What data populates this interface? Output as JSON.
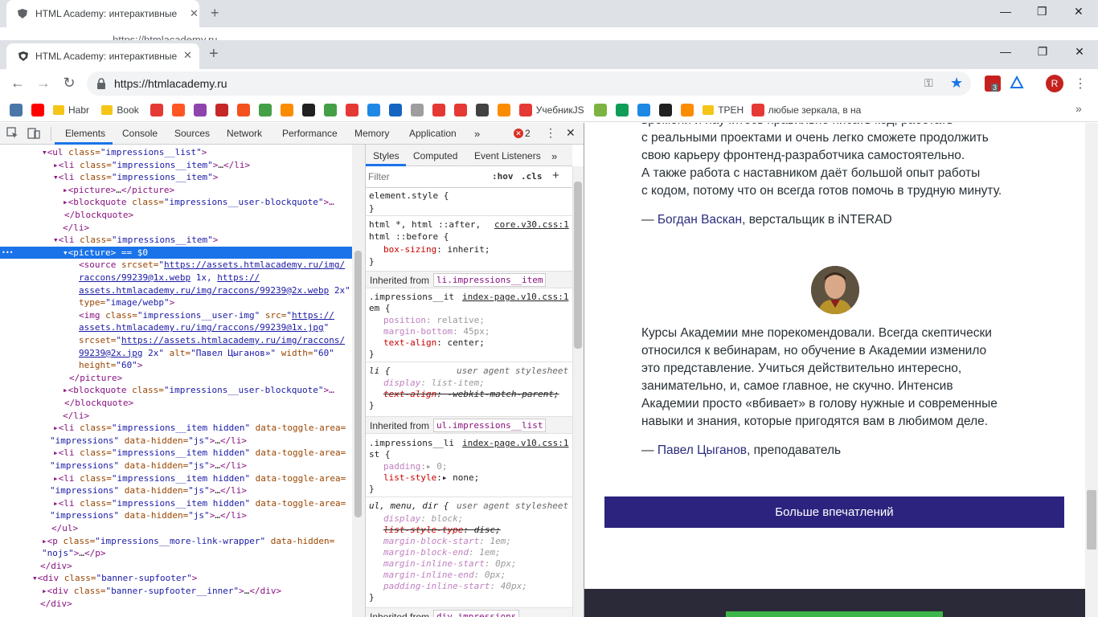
{
  "browser": {
    "tab_title": "HTML Academy: интерактивные",
    "url": "https://htmlacademy.ru",
    "ghost_url": "https://htmlacademy.ru",
    "profile_initial": "R",
    "ext_badge": "3"
  },
  "bookmarks": [
    {
      "label": "",
      "color": "#4a76a8"
    },
    {
      "label": "",
      "color": "#ff0000"
    },
    {
      "label": "Habr",
      "folder": true
    },
    {
      "label": "Book",
      "folder": true
    },
    {
      "label": "",
      "color": "#e53935"
    },
    {
      "label": "",
      "color": "#ff5722"
    },
    {
      "label": "",
      "color": "#8e44ad"
    },
    {
      "label": "",
      "color": "#c62828"
    },
    {
      "label": "",
      "color": "#f4511e"
    },
    {
      "label": "",
      "color": "#43a047"
    },
    {
      "label": "",
      "color": "#fb8c00"
    },
    {
      "label": "",
      "color": "#212121"
    },
    {
      "label": "",
      "color": "#43a047"
    },
    {
      "label": "",
      "color": "#e53935"
    },
    {
      "label": "",
      "color": "#1e88e5"
    },
    {
      "label": "",
      "color": "#1565c0"
    },
    {
      "label": "",
      "color": "#9e9e9e"
    },
    {
      "label": "",
      "color": "#e53935"
    },
    {
      "label": "",
      "color": "#e53935"
    },
    {
      "label": "",
      "color": "#424242"
    },
    {
      "label": "",
      "color": "#fb8c00"
    },
    {
      "label": "УчебникJS",
      "color": "#e53935"
    },
    {
      "label": "",
      "color": "#7cb342"
    },
    {
      "label": "",
      "color": "#0f9d58"
    },
    {
      "label": "",
      "color": "#1e88e5"
    },
    {
      "label": "",
      "color": "#212121"
    },
    {
      "label": "",
      "color": "#fb8c00"
    },
    {
      "label": "ТРЕН",
      "folder": true
    },
    {
      "label": "любые зеркала, в на",
      "color": "#e53935"
    }
  ],
  "devtools": {
    "tabs": [
      "Elements",
      "Console",
      "Sources",
      "Network",
      "Performance",
      "Memory",
      "Application"
    ],
    "error_count": "2",
    "styles_tabs": [
      "Styles",
      "Computed",
      "Event Listeners"
    ],
    "filter_placeholder": "Filter",
    "hov": ":hov",
    "cls": ".cls"
  },
  "elements_tree": [
    [
      {
        "t": "▾<"
      },
      {
        "t": "ul"
      },
      {
        "a": " class="
      },
      {
        "v": "\"impressions__list\""
      },
      {
        "t": ">"
      }
    ],
    [
      {
        "t": "▸<li "
      },
      {
        "a": "class="
      },
      {
        "v": "\"impressions__item\""
      },
      {
        "t": ">"
      },
      {
        "x": "…"
      },
      {
        "t": "</li>"
      }
    ],
    [
      {
        "t": "▾<li "
      },
      {
        "a": "class="
      },
      {
        "v": "\"impressions__item\""
      },
      {
        "t": ">"
      }
    ],
    [
      {
        "t": "▸<picture>"
      },
      {
        "x": "…"
      },
      {
        "t": "</picture>"
      }
    ],
    [
      {
        "t": "▸<blockquote "
      },
      {
        "a": "class="
      },
      {
        "v": "\"impressions__user-blockquote\""
      },
      {
        "t": ">…"
      }
    ],
    [
      {
        "t": "</blockquote>"
      }
    ],
    [
      {
        "t": "</li>"
      }
    ],
    [
      {
        "t": "▾<li "
      },
      {
        "a": "class="
      },
      {
        "v": "\"impressions__item\""
      },
      {
        "t": ">"
      }
    ],
    [
      {
        "t": "▾<picture>"
      },
      {
        "x": " == $0"
      }
    ],
    [
      {
        "t": "<source "
      },
      {
        "a": "srcset="
      },
      {
        "v": "\""
      },
      {
        "l": "https://assets.htmlacademy.ru/img/"
      }
    ],
    [
      {
        "l": "raccons/99239@1x.webp"
      },
      {
        "v": " 1x, "
      },
      {
        "l": "https://"
      }
    ],
    [
      {
        "l": "assets.htmlacademy.ru/img/raccons/99239@2x.webp"
      },
      {
        "v": " 2x\""
      }
    ],
    [
      {
        "a": "type="
      },
      {
        "v": "\"image/webp\""
      },
      {
        "t": ">"
      }
    ],
    [
      {
        "t": "<img "
      },
      {
        "a": "class="
      },
      {
        "v": "\"impressions__user-img\""
      },
      {
        "a": " src="
      },
      {
        "v": "\""
      },
      {
        "l": "https://"
      }
    ],
    [
      {
        "l": "assets.htmlacademy.ru/img/raccons/99239@1x.jpg"
      },
      {
        "v": "\""
      }
    ],
    [
      {
        "a": "srcset="
      },
      {
        "v": "\""
      },
      {
        "l": "https://assets.htmlacademy.ru/img/raccons/"
      }
    ],
    [
      {
        "l": "99239@2x.jpg"
      },
      {
        "v": " 2x\""
      },
      {
        "a": " alt="
      },
      {
        "v": "\"Павел Цыганов»\""
      },
      {
        "a": " width="
      },
      {
        "v": "\"60\""
      }
    ],
    [
      {
        "a": "height="
      },
      {
        "v": "\"60\""
      },
      {
        "t": ">"
      }
    ],
    [
      {
        "t": "</picture>"
      }
    ],
    [
      {
        "t": "▸<blockquote "
      },
      {
        "a": "class="
      },
      {
        "v": "\"impressions__user-blockquote\""
      },
      {
        "t": ">…"
      }
    ],
    [
      {
        "t": "</blockquote>"
      }
    ],
    [
      {
        "t": "</li>"
      }
    ],
    [
      {
        "t": "▸<li "
      },
      {
        "a": "class="
      },
      {
        "v": "\"impressions__item hidden\""
      },
      {
        "a": " data-toggle-area="
      }
    ],
    [
      {
        "v": "\"impressions\""
      },
      {
        "a": " data-hidden="
      },
      {
        "v": "\"js\""
      },
      {
        "t": ">"
      },
      {
        "x": "…"
      },
      {
        "t": "</li>"
      }
    ],
    [
      {
        "t": "▸<li "
      },
      {
        "a": "class="
      },
      {
        "v": "\"impressions__item hidden\""
      },
      {
        "a": " data-toggle-area="
      }
    ],
    [
      {
        "v": "\"impressions\""
      },
      {
        "a": " data-hidden="
      },
      {
        "v": "\"js\""
      },
      {
        "t": ">"
      },
      {
        "x": "…"
      },
      {
        "t": "</li>"
      }
    ],
    [
      {
        "t": "▸<li "
      },
      {
        "a": "class="
      },
      {
        "v": "\"impressions__item hidden\""
      },
      {
        "a": " data-toggle-area="
      }
    ],
    [
      {
        "v": "\"impressions\""
      },
      {
        "a": " data-hidden="
      },
      {
        "v": "\"js\""
      },
      {
        "t": ">"
      },
      {
        "x": "…"
      },
      {
        "t": "</li>"
      }
    ],
    [
      {
        "t": "▸<li "
      },
      {
        "a": "class="
      },
      {
        "v": "\"impressions__item hidden\""
      },
      {
        "a": " data-toggle-area="
      }
    ],
    [
      {
        "v": "\"impressions\""
      },
      {
        "a": " data-hidden="
      },
      {
        "v": "\"js\""
      },
      {
        "t": ">"
      },
      {
        "x": "…"
      },
      {
        "t": "</li>"
      }
    ],
    [
      {
        "t": "</ul>"
      }
    ],
    [
      {
        "t": "▸<p "
      },
      {
        "a": "class="
      },
      {
        "v": "\"impressions__more-link-wrapper\""
      },
      {
        "a": " data-hidden="
      }
    ],
    [
      {
        "v": "\"nojs\""
      },
      {
        "t": ">"
      },
      {
        "x": "…"
      },
      {
        "t": "</p>"
      }
    ],
    [
      {
        "t": "</div>"
      }
    ],
    [
      {
        "t": "▾<div "
      },
      {
        "a": "class="
      },
      {
        "v": "\"banner-supfooter\""
      },
      {
        "t": ">"
      }
    ],
    [
      {
        "t": "▸<div "
      },
      {
        "a": "class="
      },
      {
        "v": "\"banner-supfooter__inner\""
      },
      {
        "t": ">"
      },
      {
        "x": "…"
      },
      {
        "t": "</div>"
      }
    ],
    [
      {
        "t": "</div>"
      }
    ]
  ],
  "styles_panel": {
    "element_style": "element.style {",
    "rule1_selector1": "html *, html ::after,",
    "rule1_selector2": "html ::before {",
    "rule1_source": "core.v30.css:1",
    "rule1_prop": "box-sizing",
    "rule1_val": "inherit;",
    "inherited_label": "Inherited from",
    "inh1": "li.impressions__item",
    "rule2_selector1": ".impressions__it",
    "rule2_selector2": "em {",
    "rule2_source": "index-page.v10.css:1",
    "rule2_p1": "position",
    "rule2_v1": "relative;",
    "rule2_p2": "margin-bottom",
    "rule2_v2": "45px;",
    "rule2_p3": "text-align",
    "rule2_v3": "center;",
    "rule3_selector": "li {",
    "ua_label": "user agent stylesheet",
    "rule3_p1": "display",
    "rule3_v1": "list-item;",
    "rule3_p2": "text-align",
    "rule3_v2": "-webkit-match-parent;",
    "inh2": "ul.impressions__list",
    "rule4_selector1": ".impressions__li",
    "rule4_selector2": "st {",
    "rule4_source": "index-page.v10.css:1",
    "rule4_p1": "padding",
    "rule4_v1": "0;",
    "rule4_p2": "list-style",
    "rule4_v2": "none;",
    "rule5_selector": "ul, menu, dir {",
    "rule5_p1": "display",
    "rule5_v1": "block;",
    "rule5_p2": "list-style-type",
    "rule5_v2": "disc;",
    "rule5_p3": "margin-block-start",
    "rule5_v3": "1em;",
    "rule5_p4": "margin-block-end",
    "rule5_v4": "1em;",
    "rule5_p5": "margin-inline-start",
    "rule5_v5": "0px;",
    "rule5_p6": "margin-inline-end",
    "rule5_v6": "0px;",
    "rule5_p7": "padding-inline-start",
    "rule5_v7": "40px;",
    "inh3": "div.impressions"
  },
  "page": {
    "para1": [
      "времени и научитесь правильно писать код, работать",
      "с реальными проектами и очень легко сможете продолжить",
      "свою карьеру фронтенд-разработчика самостоятельно.",
      "А также работа с наставником даёт большой опыт работы",
      "с кодом, потому что он всегда готов помочь в трудную минуту."
    ],
    "author1_dash": "— ",
    "author1_name": "Богдан Васкан",
    "author1_role": ", верстальщик в iNTERAD",
    "para2": [
      "Курсы Академии мне порекомендовали. Всегда скептически",
      "относился к вебинарам, но обучение в Академии изменило",
      "это представление. Учиться действительно интересно,",
      "занимательно, и, самое главное, не скучно. Интенсив",
      "Академии просто «вбивает» в голову нужные и современные",
      "навыки и знания, которые пригодятся вам в любимом деле."
    ],
    "author2_dash": "— ",
    "author2_name": "Павел Цыганов",
    "author2_role": ", преподаватель",
    "more_button": "Больше впечатлений"
  }
}
